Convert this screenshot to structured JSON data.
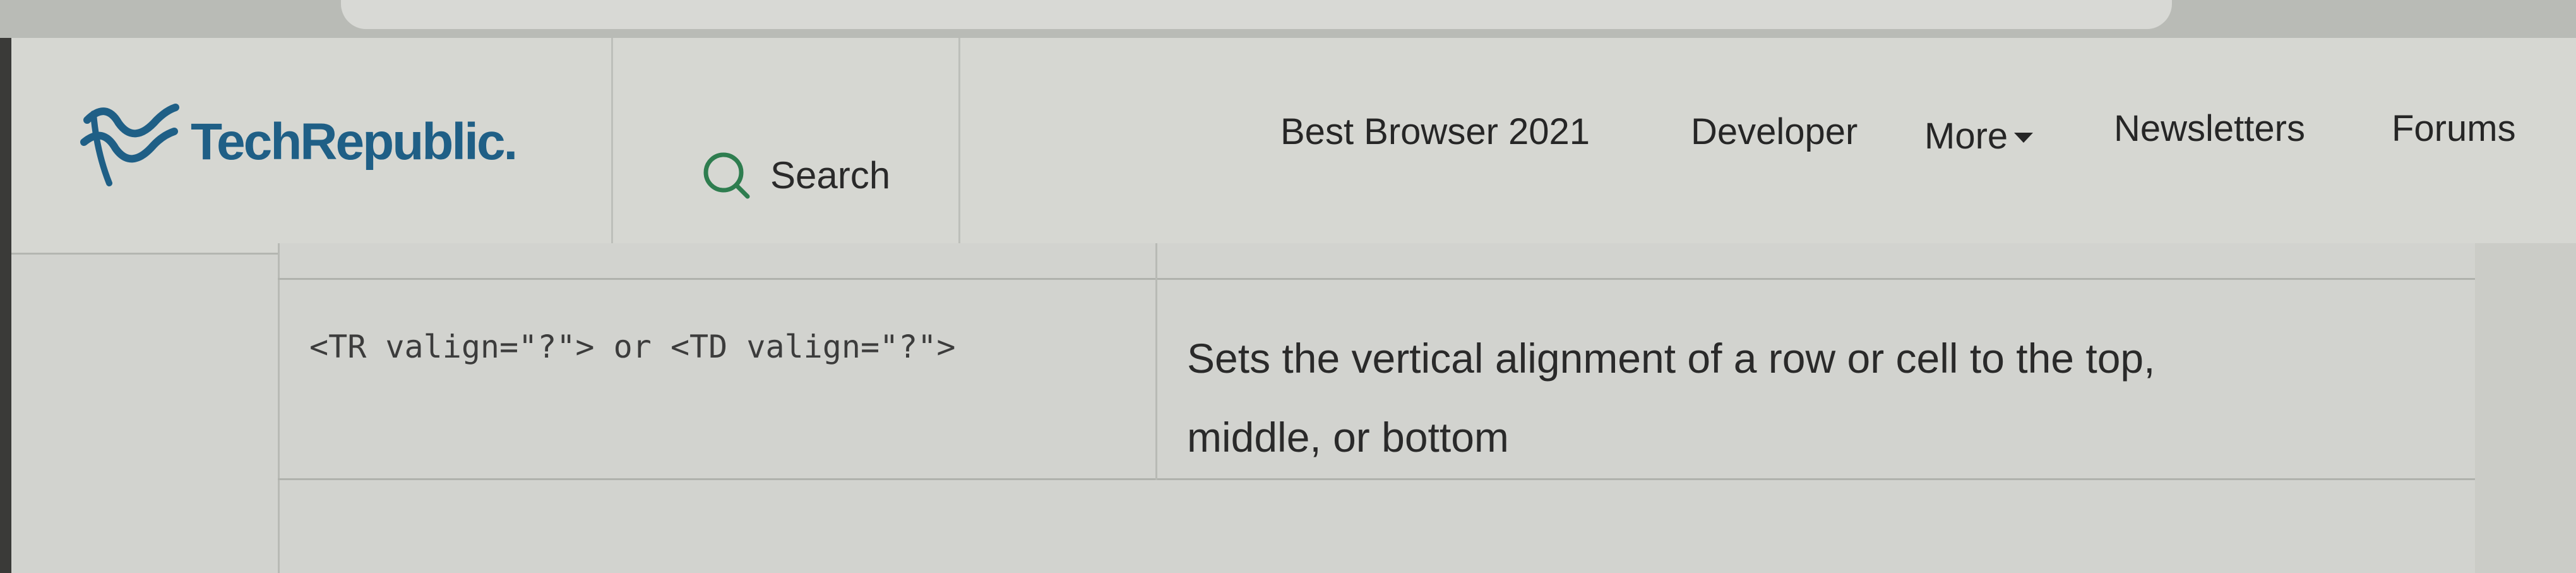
{
  "header": {
    "logo_text": "TechRepublic.",
    "search_label": "Search",
    "nav": [
      {
        "label": "Best Browser 2021"
      },
      {
        "label": "Developer"
      },
      {
        "label": "More"
      },
      {
        "label": "Newsletters"
      },
      {
        "label": "Forums"
      }
    ]
  },
  "table": {
    "rows": [
      {
        "code": "<TR valign=\"?\"> or <TD valign=\"?\">",
        "description_line1": "Sets the vertical alignment of a row or cell to the top,",
        "description_line2": "middle, or bottom"
      }
    ]
  },
  "colors": {
    "brand": "#1f5f86",
    "text": "#2a2a2a",
    "search_icon": "#2e7d4f"
  },
  "icons": {
    "logo": "techrepublic-logo-icon",
    "search": "search-icon",
    "more": "chevron-down-icon"
  }
}
